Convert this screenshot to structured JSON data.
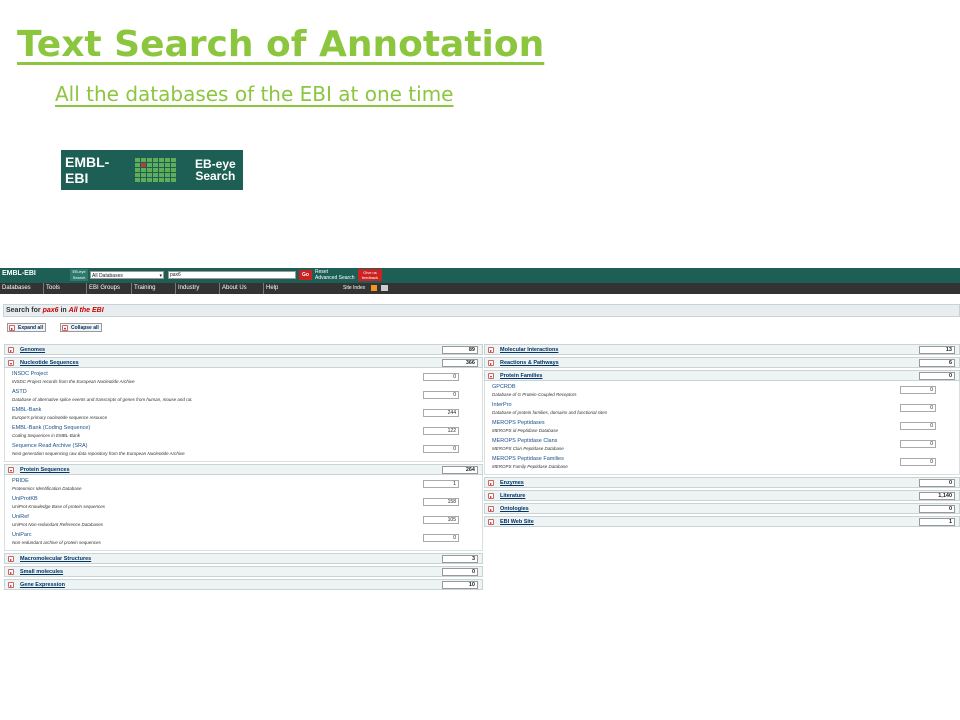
{
  "slide": {
    "title": "Text Search of Annotation",
    "subtitle": "All the databases of the EBI at one time"
  },
  "logo": {
    "brand": "EMBL-EBI",
    "product_line1": "EB-eye",
    "product_line2": "Search"
  },
  "topbar": {
    "brand": "EMBL-EBI",
    "eb_line1": "EB-eye",
    "eb_line2": "Search",
    "database_select": "All Databases",
    "query": "pax6",
    "go_label": "Go",
    "reset_label": "Reset",
    "advanced_label": "Advanced Search",
    "feedback_line1": "Give us",
    "feedback_line2": "feedback"
  },
  "nav": {
    "items": [
      "Databases",
      "Tools",
      "EBI Groups",
      "Training",
      "Industry",
      "About Us",
      "Help"
    ],
    "site_index": "Site Index"
  },
  "search_header": {
    "prefix": "Search for ",
    "term": "pax6",
    "mid": " in ",
    "scope": "All the EBI"
  },
  "controls": {
    "expand_all": "Expand all",
    "collapse_all": "Collapse all"
  },
  "left": [
    {
      "name": "Genomes",
      "count": "89",
      "expanded": false,
      "items": []
    },
    {
      "name": "Nucleotide Sequences",
      "count": "366",
      "expanded": true,
      "items": [
        {
          "name": "INSDC Project",
          "desc": "INSDC Project records from the European Nucleotide Archive",
          "count": "0"
        },
        {
          "name": "ASTD",
          "desc": "Database of alternative splice events and transcripts of genes from human, mouse and rat.",
          "count": "0"
        },
        {
          "name": "EMBL-Bank",
          "desc": "Europe's primary nucleotide sequence resource",
          "count": "244"
        },
        {
          "name": "EMBL-Bank (Coding Sequence)",
          "desc": "Coding Sequences in EMBL-Bank",
          "count": "122"
        },
        {
          "name": "Sequence Read Archive (SRA)",
          "desc": "Next generation sequencing raw data repository from the European Nucleotide Archive",
          "count": "0"
        }
      ]
    },
    {
      "name": "Protein Sequences",
      "count": "264",
      "expanded": true,
      "items": [
        {
          "name": "PRIDE",
          "desc": "Proteomics Identification Database",
          "count": "1"
        },
        {
          "name": "UniProtKB",
          "desc": "UniProt Knowledge Base of protein sequences",
          "count": "158"
        },
        {
          "name": "UniRef",
          "desc": "UniProt Non-redundant Reference Databases",
          "count": "105"
        },
        {
          "name": "UniParc",
          "desc": "Non-redundant archive of protein sequences",
          "count": "0"
        }
      ]
    },
    {
      "name": "Macromolecular Structures",
      "count": "3",
      "expanded": false,
      "items": []
    },
    {
      "name": "Small molecules",
      "count": "0",
      "expanded": false,
      "items": []
    },
    {
      "name": "Gene Expression",
      "count": "10",
      "expanded": false,
      "items": []
    }
  ],
  "right": [
    {
      "name": "Molecular Interactions",
      "count": "13",
      "expanded": false,
      "items": []
    },
    {
      "name": "Reactions & Pathways",
      "count": "6",
      "expanded": false,
      "items": []
    },
    {
      "name": "Protein Families",
      "count": "0",
      "expanded": true,
      "items": [
        {
          "name": "GPCRDB",
          "desc": "Database of G Protein-Coupled Receptors",
          "count": "0"
        },
        {
          "name": "InterPro",
          "desc": "Database of protein families, domains and functional sites",
          "count": "0"
        },
        {
          "name": "MEROPS Peptidases",
          "desc": "MEROPS id Peptidase Database",
          "count": "0"
        },
        {
          "name": "MEROPS Peptidase Clans",
          "desc": "MEROPS Clan Peptidase Database",
          "count": "0"
        },
        {
          "name": "MEROPS Peptidase Families",
          "desc": "MEROPS Family Peptidase Database",
          "count": "0"
        }
      ]
    },
    {
      "name": "Enzymes",
      "count": "0",
      "expanded": false,
      "items": []
    },
    {
      "name": "Literature",
      "count": "1,140",
      "expanded": false,
      "items": []
    },
    {
      "name": "Ontologies",
      "count": "0",
      "expanded": false,
      "items": []
    },
    {
      "name": "EBI Web Site",
      "count": "1",
      "expanded": false,
      "items": []
    }
  ],
  "colors": {
    "accent": "#8cc63f",
    "brand_bar": "#1e5f55",
    "nav_bar": "#333333"
  }
}
